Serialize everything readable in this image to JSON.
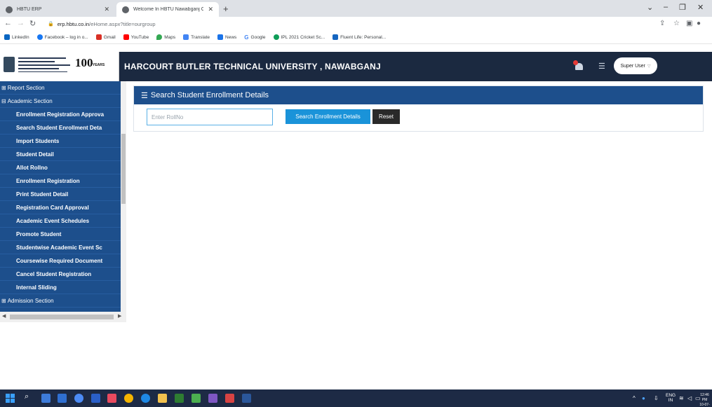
{
  "browser": {
    "tabs": [
      {
        "title": "HBTU ERP",
        "active": false
      },
      {
        "title": "Welcome In HBTU Nawabganj Ca",
        "active": true
      }
    ],
    "new_tab": "+",
    "url_domain": "erp.hbtu.co.in",
    "url_path": "/eHome.aspx?title=ourgroup",
    "bookmarks": [
      {
        "label": "LinkedIn",
        "color": "#0a66c2"
      },
      {
        "label": "Facebook – log in o...",
        "color": "#1877f2"
      },
      {
        "label": "Gmail",
        "color": "#d93025"
      },
      {
        "label": "YouTube",
        "color": "#ff0000"
      },
      {
        "label": "Maps",
        "color": "#34a853"
      },
      {
        "label": "Translate",
        "color": "#4285f4"
      },
      {
        "label": "News",
        "color": "#1a73e8"
      },
      {
        "label": "Google",
        "color": "#4285f4"
      },
      {
        "label": "IPL 2021 Cricket Sc...",
        "color": "#0f9d58"
      },
      {
        "label": "Fluent Life: Personal...",
        "color": "#1565c0"
      }
    ]
  },
  "header": {
    "logo_text": "100",
    "logo_sub": "YEARS",
    "title": "HARCOURT BUTLER TECHNICAL UNIVERSITY , NAWABGANJ",
    "user_label": "Super User"
  },
  "sidebar": {
    "items": [
      {
        "label": "Report Section",
        "type": "section",
        "symbol": "⊞"
      },
      {
        "label": "Academic Section",
        "type": "section",
        "symbol": "⊟"
      },
      {
        "label": "Enrollment Registration Approva",
        "type": "sub"
      },
      {
        "label": "Search Student Enrollment Deta",
        "type": "sub"
      },
      {
        "label": "Import Students",
        "type": "sub"
      },
      {
        "label": "Student Detail",
        "type": "sub"
      },
      {
        "label": "Allot Rollno",
        "type": "sub"
      },
      {
        "label": "Enrollment Registration",
        "type": "sub"
      },
      {
        "label": "Print Student Detail",
        "type": "sub"
      },
      {
        "label": "Registration Card Approval",
        "type": "sub"
      },
      {
        "label": "Academic Event Schedules",
        "type": "sub"
      },
      {
        "label": "Promote Student",
        "type": "sub"
      },
      {
        "label": "Studentwise Academic Event Sc",
        "type": "sub"
      },
      {
        "label": "Coursewise Required Document",
        "type": "sub"
      },
      {
        "label": "Cancel Student Registration",
        "type": "sub"
      },
      {
        "label": "Internal Sliding",
        "type": "sub"
      },
      {
        "label": "Admission Section",
        "type": "section",
        "symbol": "⊞"
      }
    ]
  },
  "main": {
    "panel_title": "Search Student Enrollment Details",
    "rollno_placeholder": "Enter RollNo",
    "rollno_value": "",
    "search_button": "Search Enrollment Details",
    "reset_button": "Reset"
  },
  "taskbar": {
    "language": "ENG",
    "region": "IN",
    "time": "12:46 PM",
    "date": "10-07-2022"
  }
}
